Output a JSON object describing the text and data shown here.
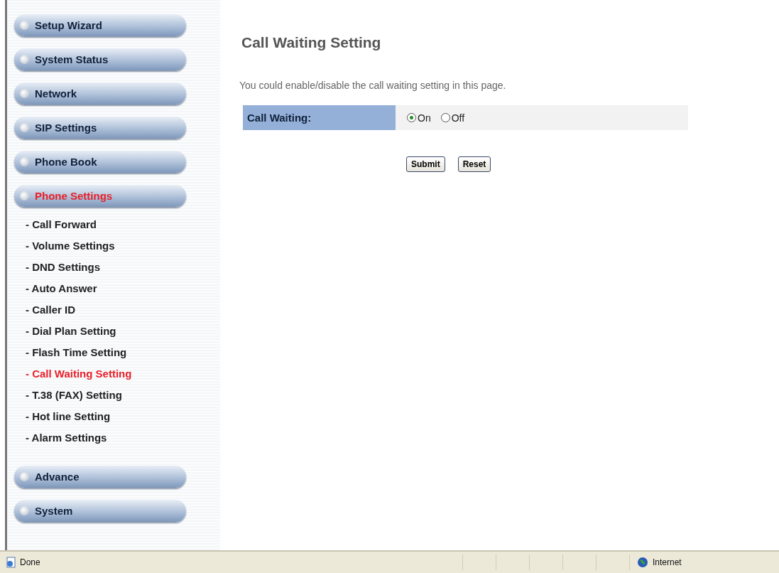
{
  "sidebar": {
    "items": [
      {
        "label": "Setup Wizard",
        "selected": false
      },
      {
        "label": "System Status",
        "selected": false
      },
      {
        "label": "Network",
        "selected": false
      },
      {
        "label": "SIP Settings",
        "selected": false
      },
      {
        "label": "Phone Book",
        "selected": false
      },
      {
        "label": "Phone Settings",
        "selected": true,
        "children": [
          {
            "label": "- Call Forward",
            "selected": false
          },
          {
            "label": "- Volume Settings",
            "selected": false
          },
          {
            "label": "- DND Settings",
            "selected": false
          },
          {
            "label": "- Auto Answer",
            "selected": false
          },
          {
            "label": "- Caller ID",
            "selected": false
          },
          {
            "label": "- Dial Plan Setting",
            "selected": false
          },
          {
            "label": "- Flash Time Setting",
            "selected": false
          },
          {
            "label": "- Call Waiting Setting",
            "selected": true
          },
          {
            "label": "- T.38 (FAX) Setting",
            "selected": false
          },
          {
            "label": "- Hot line Setting",
            "selected": false
          },
          {
            "label": "- Alarm Settings",
            "selected": false
          }
        ]
      },
      {
        "label": "Advance",
        "selected": false
      },
      {
        "label": "System",
        "selected": false
      }
    ]
  },
  "main": {
    "title": "Call Waiting Setting",
    "description": "You could enable/disable the call waiting setting in this page.",
    "form": {
      "label": "Call Waiting:",
      "options": [
        {
          "label": "On",
          "selected": true
        },
        {
          "label": "Off",
          "selected": false
        }
      ]
    },
    "buttons": [
      "Submit",
      "Reset"
    ]
  },
  "status_bar": {
    "status": "Done",
    "zone": "Internet"
  }
}
